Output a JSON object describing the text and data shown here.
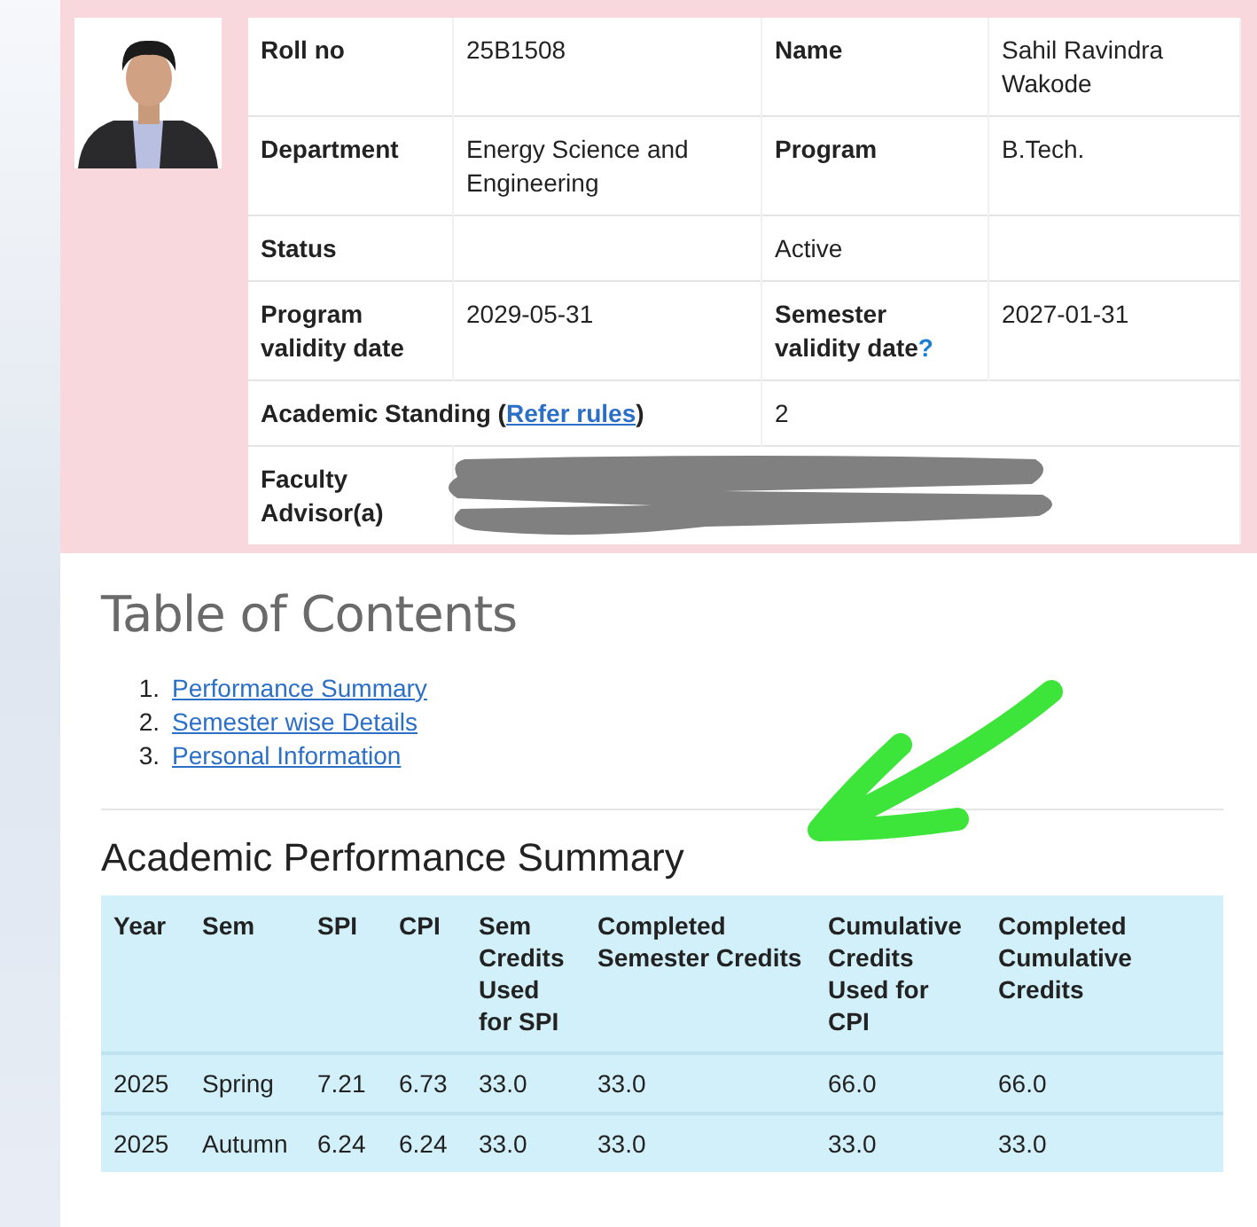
{
  "profile": {
    "rows": [
      {
        "cells": [
          {
            "text": "Roll no",
            "kind": "label"
          },
          {
            "text": "25B1508",
            "kind": "value"
          },
          {
            "text": "Name",
            "kind": "label"
          },
          {
            "text": "Sahil Ravindra Wakode",
            "kind": "value"
          }
        ]
      },
      {
        "cells": [
          {
            "text": "Department",
            "kind": "label"
          },
          {
            "text": "Energy Science and Engineering",
            "kind": "value"
          },
          {
            "text": "Program",
            "kind": "label"
          },
          {
            "text": "B.Tech.",
            "kind": "value"
          }
        ]
      },
      {
        "cells": [
          {
            "text": "Status",
            "kind": "label"
          },
          {
            "kind": "blank"
          },
          {
            "text": "Active",
            "kind": "value"
          },
          {
            "kind": "blank"
          }
        ]
      },
      {
        "cells": [
          {
            "text": "Program validity date",
            "kind": "label"
          },
          {
            "text": "2029-05-31",
            "kind": "value"
          },
          {
            "text": "Semester validity date",
            "kind": "label",
            "help": "?"
          },
          {
            "text": "2027-01-31",
            "kind": "value"
          }
        ]
      },
      {
        "cells": [
          {
            "text": "Academic Standing (",
            "kind": "wide_label",
            "link": "Refer rules",
            "after": ")",
            "colspan": 2
          },
          {
            "text": "2",
            "kind": "wide_value",
            "colspan": 2
          }
        ]
      },
      {
        "cells": [
          {
            "text": "Faculty Advisor(a)",
            "kind": "label"
          },
          {
            "kind": "redacted",
            "colspan": 3
          }
        ]
      }
    ]
  },
  "toc": {
    "title": "Table of Contents",
    "items": [
      {
        "number": "1.",
        "label": "Performance Summary"
      },
      {
        "number": "2.",
        "label": "Semester wise Details"
      },
      {
        "number": "3.",
        "label": "Personal Information"
      }
    ]
  },
  "summary": {
    "title": "Academic Performance Summary",
    "columns": [
      "Year",
      "Sem",
      "SPI",
      "CPI",
      "Sem Credits Used for SPI",
      "Completed Semester Credits",
      "Cumulative Credits Used for CPI",
      "Completed Cumulative Credits"
    ],
    "rows": [
      [
        "2025",
        "Spring",
        "7.21",
        "6.73",
        "33.0",
        "33.0",
        "66.0",
        "66.0"
      ],
      [
        "2025",
        "Autumn",
        "6.24",
        "6.24",
        "33.0",
        "33.0",
        "33.0",
        "33.0"
      ]
    ]
  },
  "annotation": {
    "kind": "arrow"
  }
}
